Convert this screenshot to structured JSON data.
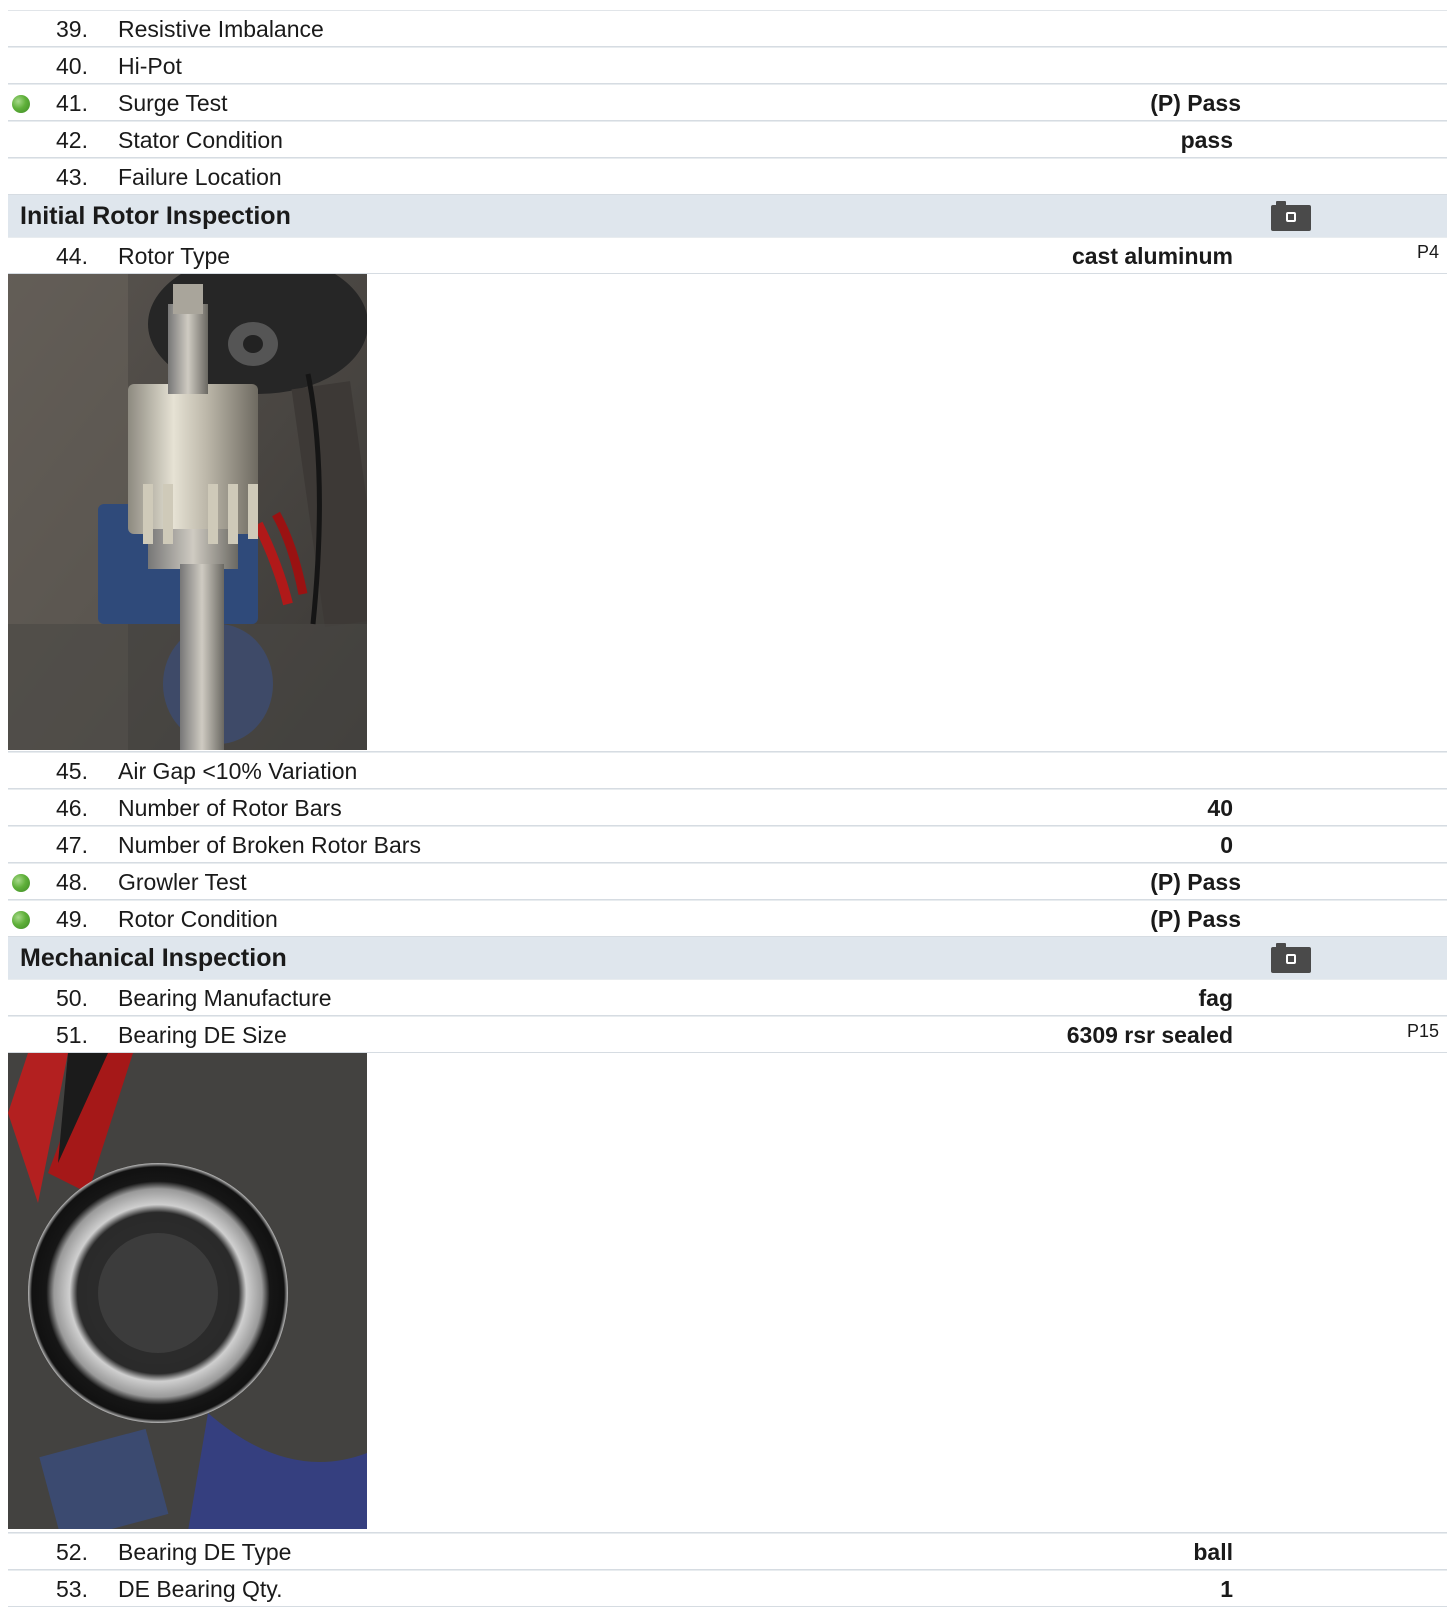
{
  "rows_a": [
    {
      "num": "39.",
      "label": "Resistive Imbalance",
      "value": ""
    },
    {
      "num": "40.",
      "label": "Hi-Pot",
      "value": ""
    },
    {
      "num": "41.",
      "label": "Surge Test",
      "value": "(P) Pass",
      "status": "pass"
    },
    {
      "num": "42.",
      "label": "Stator Condition",
      "value": "pass"
    },
    {
      "num": "43.",
      "label": "Failure Location",
      "value": ""
    }
  ],
  "section_rotor": {
    "title": "Initial Rotor Inspection",
    "icon": "camera-icon"
  },
  "row_44": {
    "num": "44.",
    "label": "Rotor Type",
    "value": "cast aluminum",
    "photo_ref": "P4"
  },
  "rows_b": [
    {
      "num": "45.",
      "label": "Air Gap <10% Variation",
      "value": ""
    },
    {
      "num": "46.",
      "label": "Number of Rotor Bars",
      "value": "40"
    },
    {
      "num": "47.",
      "label": "Number of Broken Rotor Bars",
      "value": "0"
    },
    {
      "num": "48.",
      "label": "Growler Test",
      "value": "(P) Pass",
      "status": "pass"
    },
    {
      "num": "49.",
      "label": "Rotor Condition",
      "value": "(P) Pass",
      "status": "pass"
    }
  ],
  "section_mech": {
    "title": "Mechanical Inspection",
    "icon": "camera-icon"
  },
  "row_50": {
    "num": "50.",
    "label": "Bearing Manufacture",
    "value": "fag"
  },
  "row_51": {
    "num": "51.",
    "label": "Bearing DE Size",
    "value": "6309 rsr sealed",
    "photo_ref": "P15"
  },
  "rows_c": [
    {
      "num": "52.",
      "label": "Bearing DE Type",
      "value": "ball"
    },
    {
      "num": "53.",
      "label": "DE Bearing Qty.",
      "value": "1"
    }
  ],
  "colors": {
    "section_bg": "#dfe6ed",
    "pass_dot": "#5fb03a",
    "camera": "#4a4a4a"
  }
}
